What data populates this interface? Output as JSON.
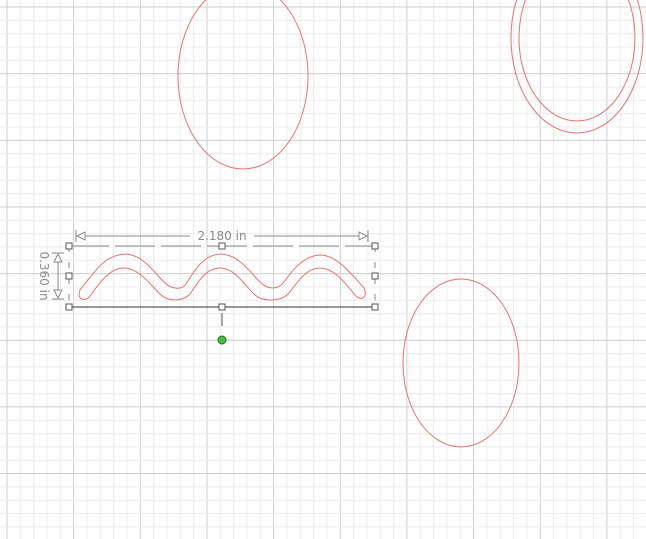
{
  "colors": {
    "grid_minor": "#ececec",
    "grid_major": "#cfcfcf",
    "shape_stroke": "#f07070",
    "dimension": "#8a8a8a",
    "rotate_handle": "#3cc43c"
  },
  "selection": {
    "width_label": "2.180 in",
    "height_label": "0.360 in"
  }
}
